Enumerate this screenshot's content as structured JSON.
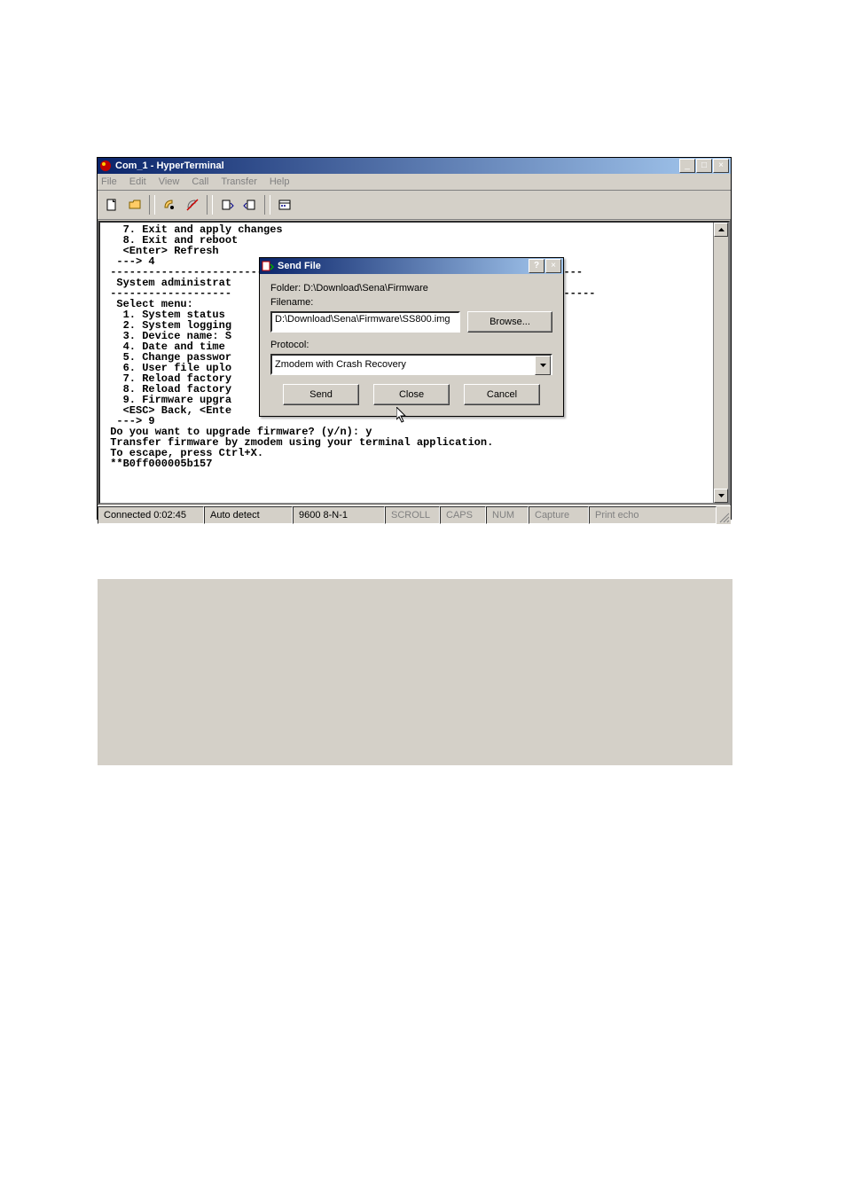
{
  "app": {
    "title": "Com_1 - HyperTerminal"
  },
  "menu": {
    "file": "File",
    "edit": "Edit",
    "view": "View",
    "call": "Call",
    "transfer": "Transfer",
    "help": "Help"
  },
  "terminal": {
    "text": "   7. Exit and apply changes\n   8. Exit and reboot\n   <Enter> Refresh\n  ---> 4\n ---------------------------                                ---------------\n  System administrat\n -------------------                                          ---------------\n  Select menu:\n   1. System status\n   2. System logging\n   3. Device name: S\n   4. Date and time\n   5. Change passwor\n   6. User file uplo\n   7. Reload factory\n   8. Reload factory\n   9. Firmware upgra\n   <ESC> Back, <Ente\n  ---> 9\n Do you want to upgrade firmware? (y/n): y\n Transfer firmware by zmodem using your terminal application.\n To escape, press Ctrl+X.\n **B0ff000005b157"
  },
  "dialog": {
    "title": "Send File",
    "folder_label": "Folder:  D:\\Download\\Sena\\Firmware",
    "filename_label": "Filename:",
    "filename_value": "D:\\Download\\Sena\\Firmware\\SS800.img",
    "browse": "Browse...",
    "protocol_label": "Protocol:",
    "protocol_value": "Zmodem with Crash Recovery",
    "send": "Send",
    "close": "Close",
    "cancel": "Cancel"
  },
  "status": {
    "connected": "Connected 0:02:45",
    "auto": "Auto detect",
    "baud": "9600 8-N-1",
    "scroll": "SCROLL",
    "caps": "CAPS",
    "num": "NUM",
    "capture": "Capture",
    "echo": "Print echo"
  }
}
